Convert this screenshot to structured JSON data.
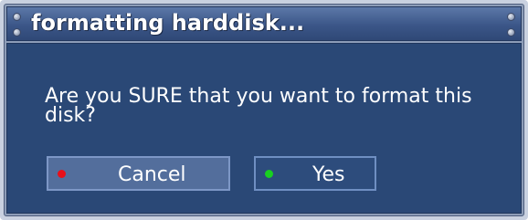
{
  "dialog": {
    "title": "formatting harddisk...",
    "message": "Are you SURE that you want to format this disk?"
  },
  "buttons": {
    "cancel": {
      "label": "Cancel",
      "dot_color": "#e8101a",
      "focused": true
    },
    "yes": {
      "label": "Yes",
      "dot_color": "#18d020",
      "focused": false
    }
  },
  "colors": {
    "title_bar": "#3b5688",
    "body": "#2a4876",
    "button_border": "#6f8fc2",
    "button_focused": "#536e9c"
  }
}
